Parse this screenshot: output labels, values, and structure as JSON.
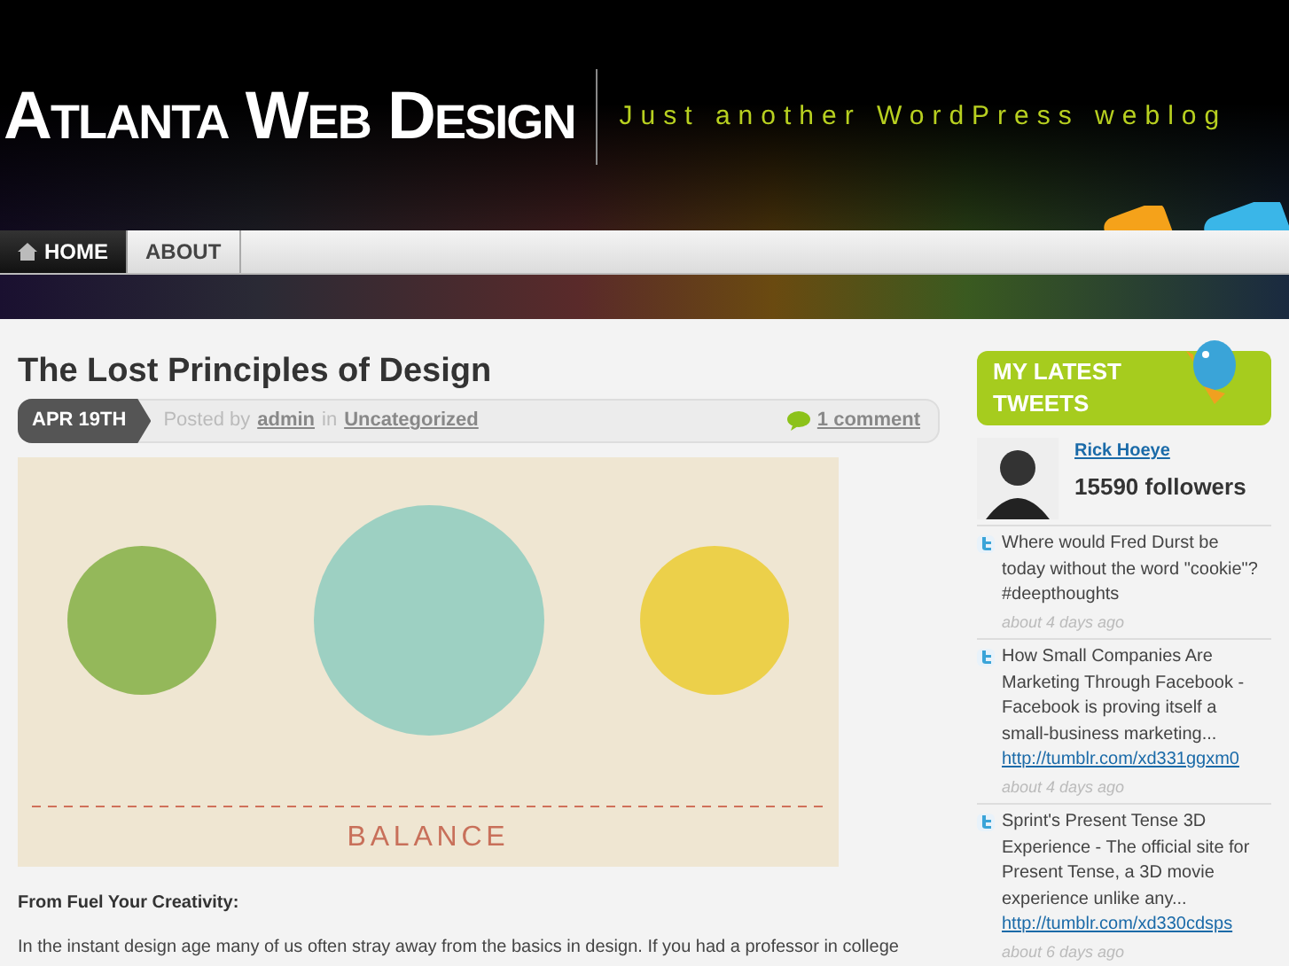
{
  "site": {
    "title": "Atlanta Web Design",
    "tagline": "Just another WordPress weblog"
  },
  "nav": [
    {
      "label": "HOME",
      "selected": true
    },
    {
      "label": "ABOUT",
      "selected": false
    }
  ],
  "post": {
    "title": "The Lost Principles of Design",
    "date": "APR 19TH",
    "posted_by": "Posted by",
    "author": "admin",
    "in_word": "in",
    "category": "Uncategorized",
    "comments": "1 comment",
    "image_caption": "BALANCE",
    "source": "From Fuel Your Creativity:",
    "body": "In the instant design age many of us often stray away from the basics in design. If you had a professor in college"
  },
  "sidebar": {
    "heading": "MY LATEST TWEETS",
    "user": "Rick Hoeye",
    "followers": "15590 followers",
    "tweets": [
      {
        "text": "Where would Fred Durst be today without the word \"cookie\"? #deepthoughts",
        "time": "about 4 days ago"
      },
      {
        "text": "How Small Companies Are Marketing Through Facebook - Facebook is proving itself a small-business marketing...",
        "link": "http://tumblr.com/xd331ggxm0",
        "time": "about 4 days ago"
      },
      {
        "text": "Sprint's Present Tense 3D Experience - The official site for Present Tense, a 3D movie experience unlike any...",
        "link": "http://tumblr.com/xd330cdsps",
        "time": "about 6 days ago"
      }
    ]
  }
}
